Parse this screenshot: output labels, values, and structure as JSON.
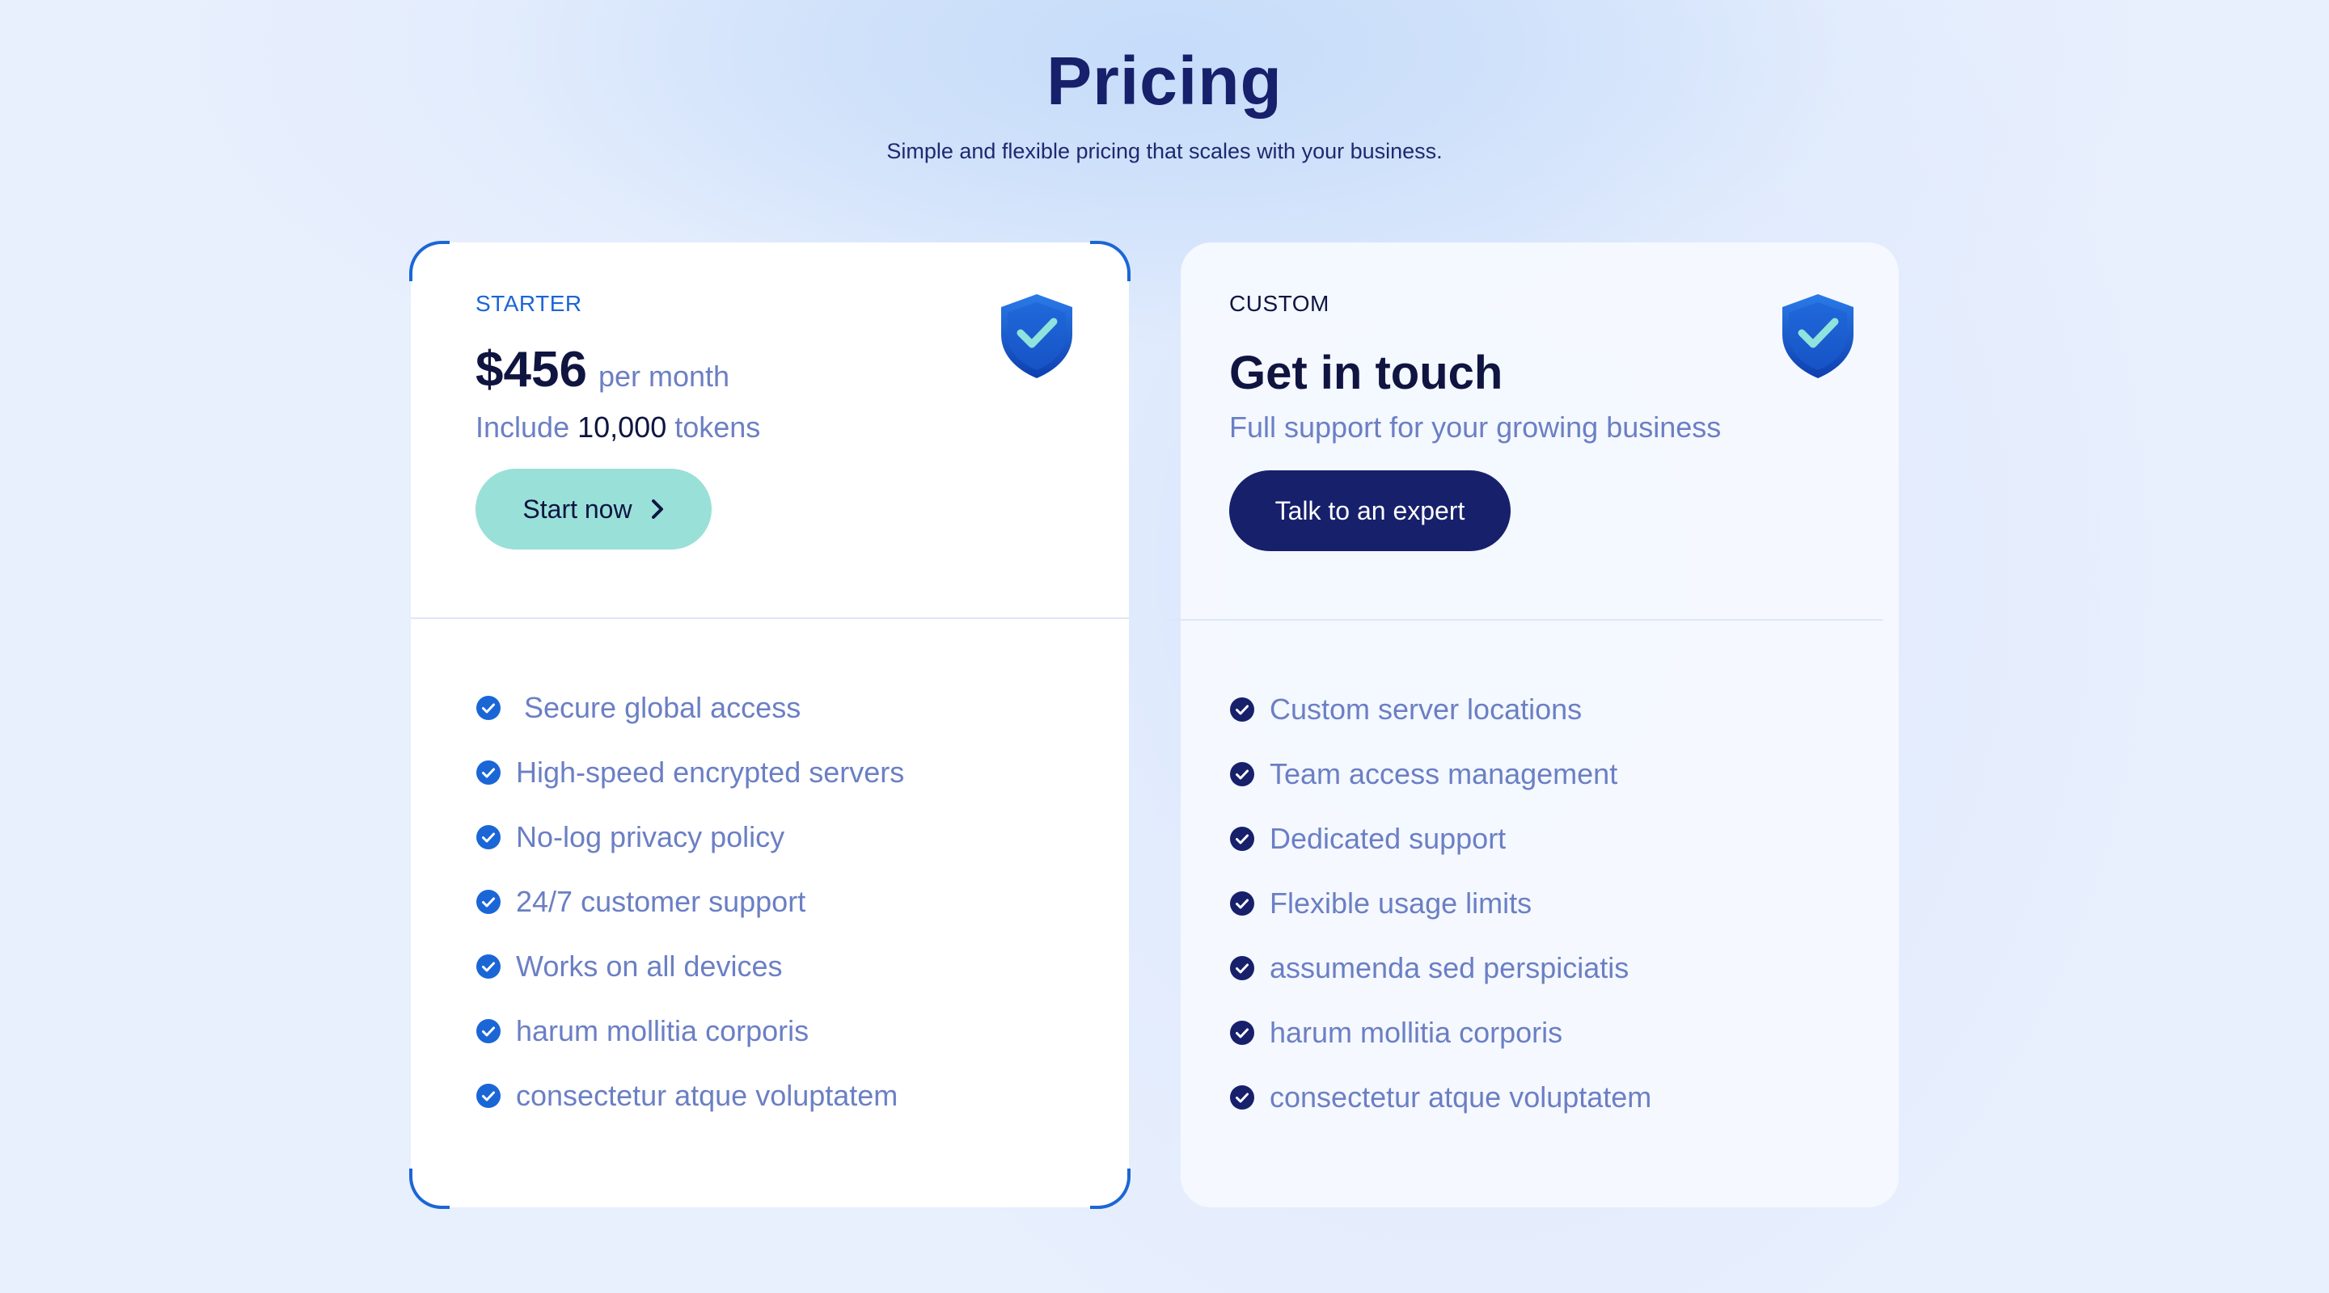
{
  "header": {
    "title": "Pricing",
    "subtitle": "Simple and flexible pricing that scales with your business."
  },
  "plans": {
    "starter": {
      "label": "STARTER",
      "price": "$456",
      "period": "per month",
      "tokens_prefix": "Include",
      "tokens_count": "10,000",
      "tokens_suffix": "tokens",
      "cta_label": "Start now",
      "features": [
        "Secure global access",
        "High-speed encrypted servers",
        "No-log privacy policy",
        "24/7 customer support",
        "Works on all devices",
        "harum mollitia corporis",
        "consectetur atque voluptatem"
      ]
    },
    "custom": {
      "label": "CUSTOM",
      "title": "Get in touch",
      "description": "Full support for your growing business",
      "cta_label": "Talk to an expert",
      "features": [
        "Custom server locations",
        "Team access management",
        "Dedicated support",
        "Flexible usage limits",
        "assumenda sed perspiciatis",
        "harum mollitia corporis",
        "consectetur atque voluptatem"
      ]
    }
  },
  "icons": {
    "plan_badge": "shield-check-icon",
    "feature_bullet": "check-circle-icon",
    "cta_arrow": "chevron-right-icon"
  },
  "colors": {
    "accent": "#1b66d6",
    "navy": "#17206b",
    "mint": "#99e0d9",
    "muted_text": "#6b7fc4"
  }
}
